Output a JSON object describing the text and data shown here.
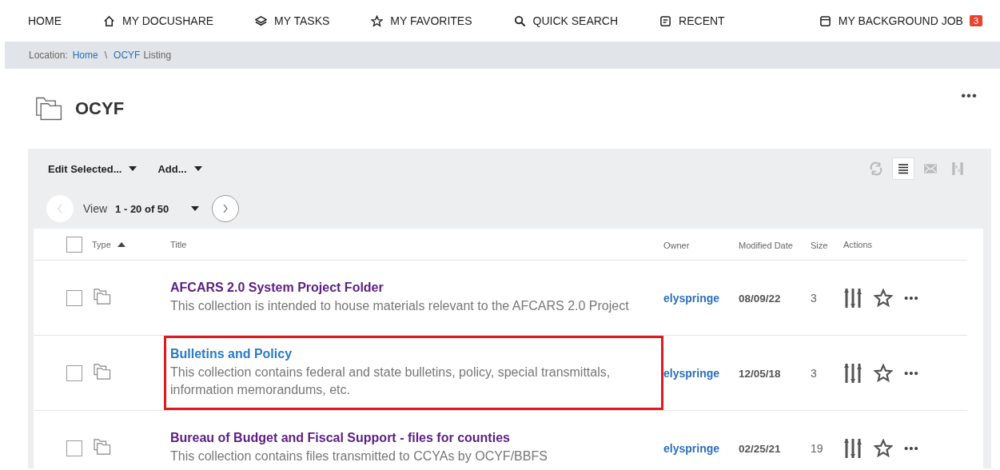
{
  "nav": {
    "items": [
      {
        "kind": "home",
        "label": "HOME"
      },
      {
        "kind": "house",
        "label": "MY DOCUSHARE"
      },
      {
        "kind": "layers",
        "label": "MY TASKS"
      },
      {
        "kind": "star",
        "label": "MY FAVORITES"
      },
      {
        "kind": "search",
        "label": "QUICK SEARCH"
      },
      {
        "kind": "recent",
        "label": "RECENT"
      }
    ],
    "background_job": {
      "label": "MY BACKGROUND JOB",
      "badge": "3"
    }
  },
  "breadcrumb": {
    "prefix": "Location:",
    "links": [
      "Home",
      "OCYF"
    ],
    "separator": "\\",
    "current": "Listing"
  },
  "heading": {
    "title": "OCYF",
    "menu": "•••"
  },
  "toolbar": {
    "menus": [
      "Edit Selected...",
      "Add..."
    ],
    "icons": [
      {
        "kind": "refresh",
        "selected": false
      },
      {
        "kind": "list",
        "selected": true
      },
      {
        "kind": "mail",
        "selected": false
      },
      {
        "kind": "split",
        "selected": false
      }
    ]
  },
  "pager": {
    "label": "View",
    "range": "1 - 20 of 50"
  },
  "table": {
    "select_all_checked": false,
    "columns": [
      "Type",
      "Title",
      "Owner",
      "Modified Date",
      "Size",
      "Actions"
    ],
    "rows": [
      {
        "title": "AFCARS 2.0 System Project Folder",
        "visited": true,
        "highlighted": false,
        "description": "This collection is intended to house materials relevant to the AFCARS 2.0 Project",
        "owner": "elyspringe",
        "modified": "08/09/22",
        "size": "3",
        "checked": false,
        "more": "•••"
      },
      {
        "title": "Bulletins and Policy",
        "visited": false,
        "highlighted": true,
        "description": "This collection contains federal and state bulletins, policy, special transmittals, information memorandums, etc.",
        "owner": "elyspringe",
        "modified": "12/05/18",
        "size": "3",
        "checked": false,
        "more": "•••"
      },
      {
        "title": "Bureau of Budget and Fiscal Support - files for counties",
        "visited": true,
        "highlighted": false,
        "description": "This collection contains files transmitted to CCYAs by OCYF/BBFS",
        "owner": "elyspringe",
        "modified": "02/25/21",
        "size": "19",
        "checked": false,
        "more": "•••"
      }
    ]
  }
}
